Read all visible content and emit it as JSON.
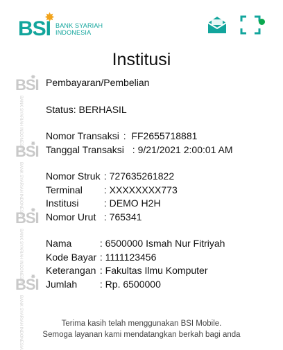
{
  "brand": {
    "logo_text": "BSI",
    "logo_sub_line1": "BANK SYARIAH",
    "logo_sub_line2": "INDONESIA"
  },
  "header": {
    "mail_icon": "mail-open-icon",
    "scan_icon": "qr-scan-frame-icon",
    "accent_color": "#12a59c",
    "status_dot_color": "#0aa84f"
  },
  "page": {
    "title": "Institusi"
  },
  "receipt": {
    "type": "Pembayaran/Pembelian",
    "status": "Status: BERHASIL",
    "nomor_transaksi_label": "Nomor Transaksi",
    "nomor_transaksi_value": "FF2655718881",
    "tanggal_transaksi_label": "Tanggal Transaksi",
    "tanggal_transaksi_value": "9/21/2021 2:00:01 AM",
    "nomor_struk_label": "Nomor Struk",
    "nomor_struk_value": "727635261822",
    "terminal_label": "Terminal",
    "terminal_value": "XXXXXXXX773",
    "institusi_label": "Institusi",
    "institusi_value": "DEMO H2H",
    "nomor_urut_label": "Nomor Urut",
    "nomor_urut_value": "765341",
    "nama_label": "Nama",
    "nama_value": "6500000 Ismah Nur Fitriyah",
    "kode_bayar_label": "Kode Bayar",
    "kode_bayar_value": "1111123456",
    "keterangan_label": "Keterangan",
    "keterangan_value": "Fakultas Ilmu Komputer",
    "jumlah_label": "Jumlah",
    "jumlah_value": "Rp. 6500000"
  },
  "footer": {
    "line1": "Terima kasih telah menggunakan BSI Mobile.",
    "line2": "Semoga layanan kami mendatangkan berkah bagi anda"
  }
}
